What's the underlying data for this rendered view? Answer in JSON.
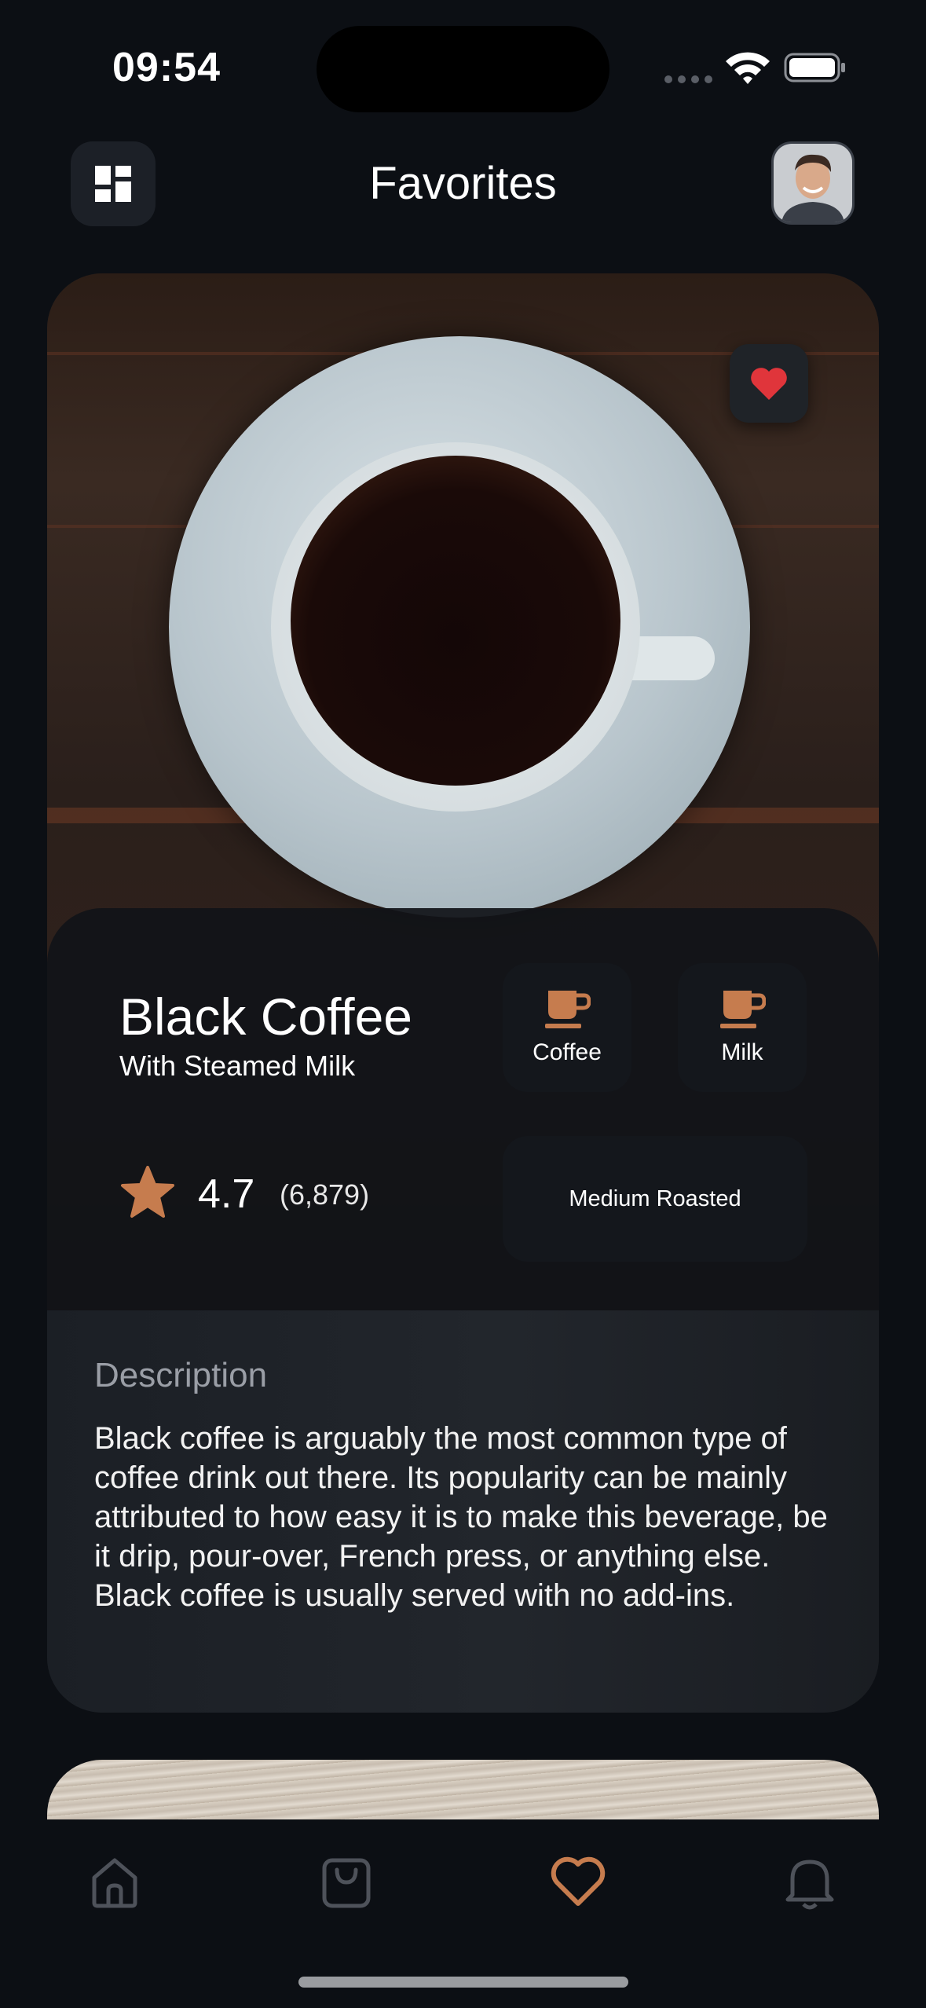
{
  "status_bar": {
    "time": "09:54"
  },
  "header": {
    "title": "Favorites"
  },
  "product": {
    "name": "Black Coffee",
    "subtitle": "With Steamed Milk",
    "tags": [
      {
        "label": "Coffee",
        "icon": "coffee-cup-icon"
      },
      {
        "label": "Milk",
        "icon": "milk-drop-icon"
      }
    ],
    "roast": "Medium Roasted",
    "rating": "4.7",
    "rating_count": "(6,879)",
    "favorited": true
  },
  "description": {
    "title": "Description",
    "text": "Black coffee is arguably the most common type of coffee drink out there. Its popularity can be mainly attributed to how easy it is to make this beverage, be it drip, pour-over, French press, or anything else. Black coffee is usually served with no add-ins."
  },
  "tab_bar": {
    "items": [
      {
        "icon": "home-icon",
        "active": false
      },
      {
        "icon": "bag-icon",
        "active": false
      },
      {
        "icon": "heart-icon",
        "active": true
      },
      {
        "icon": "bell-icon",
        "active": false
      }
    ]
  },
  "colors": {
    "accent": "#C67C4E",
    "favorite_red": "#E0353B",
    "background": "#0C0F14",
    "surface": "#14171C"
  }
}
